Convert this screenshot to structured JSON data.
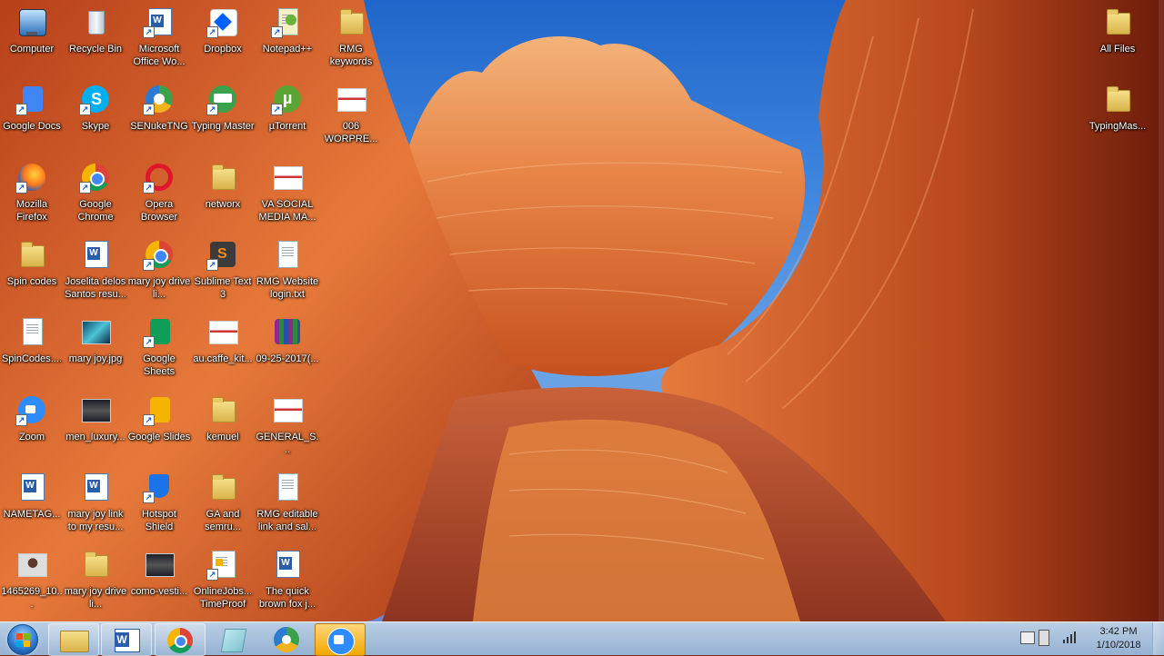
{
  "desktop": {
    "icons": [
      {
        "label": "Computer",
        "type": "computer",
        "icon": "computer-icon"
      },
      {
        "label": "Recycle Bin",
        "type": "recycle",
        "icon": "recycle-bin-icon"
      },
      {
        "label": "Microsoft Office Wo...",
        "type": "word-shortcut",
        "icon": "word-icon"
      },
      {
        "label": "Dropbox",
        "type": "dropbox",
        "icon": "dropbox-icon"
      },
      {
        "label": "Notepad++",
        "type": "notepadpp",
        "icon": "notepadpp-icon"
      },
      {
        "label": "RMG keywords",
        "type": "folder",
        "icon": "folder-icon"
      },
      {
        "label": "Google Docs",
        "type": "gdocs",
        "icon": "google-docs-icon"
      },
      {
        "label": "Skype",
        "type": "skype",
        "icon": "skype-icon"
      },
      {
        "label": "SENukeTNG",
        "type": "senuke",
        "icon": "senuke-icon"
      },
      {
        "label": "Typing Master",
        "type": "typingmaster",
        "icon": "typing-master-icon"
      },
      {
        "label": "µTorrent",
        "type": "utorrent",
        "icon": "utorrent-icon"
      },
      {
        "label": "006 WORPRE...",
        "type": "image",
        "icon": "image-file-icon"
      },
      {
        "label": "Mozilla Firefox",
        "type": "firefox",
        "icon": "firefox-icon"
      },
      {
        "label": "Google Chrome",
        "type": "chrome",
        "icon": "chrome-icon"
      },
      {
        "label": "Opera Browser",
        "type": "opera",
        "icon": "opera-icon"
      },
      {
        "label": "networx",
        "type": "folder",
        "icon": "folder-icon"
      },
      {
        "label": "VA SOCIAL MEDIA MA...",
        "type": "image",
        "icon": "image-file-icon"
      },
      {
        "label": "Spin codes",
        "type": "folder",
        "icon": "folder-icon"
      },
      {
        "label": "Joselita delos Santos resu...",
        "type": "worddoc",
        "icon": "word-document-icon"
      },
      {
        "label": "mary joy drive li...",
        "type": "chrome",
        "icon": "chrome-icon"
      },
      {
        "label": "Sublime Text 3",
        "type": "sublime",
        "icon": "sublime-text-icon"
      },
      {
        "label": "RMG Website login.txt",
        "type": "doc",
        "icon": "text-file-icon"
      },
      {
        "label": "SpinCodes....",
        "type": "doc",
        "icon": "text-file-icon"
      },
      {
        "label": "mary joy.jpg",
        "type": "photo",
        "icon": "photo-icon"
      },
      {
        "label": "Google Sheets",
        "type": "gsheets",
        "icon": "google-sheets-icon"
      },
      {
        "label": "au.caffe_kit...",
        "type": "image",
        "icon": "image-file-icon"
      },
      {
        "label": "09-25-2017(...",
        "type": "archive",
        "icon": "archive-icon"
      },
      {
        "label": "Zoom",
        "type": "zoom",
        "icon": "zoom-icon"
      },
      {
        "label": "men_luxury...",
        "type": "photo-dark",
        "icon": "photo-icon"
      },
      {
        "label": "Google Slides",
        "type": "gslides",
        "icon": "google-slides-icon"
      },
      {
        "label": "kemuel",
        "type": "folder",
        "icon": "folder-icon"
      },
      {
        "label": "GENERAL_S...",
        "type": "image",
        "icon": "image-file-icon"
      },
      {
        "label": "NAMETAG...",
        "type": "worddoc",
        "icon": "word-document-icon"
      },
      {
        "label": "mary joy link to my resu...",
        "type": "worddoc",
        "icon": "word-document-icon"
      },
      {
        "label": "Hotspot Shield",
        "type": "hotspot",
        "icon": "hotspot-shield-icon"
      },
      {
        "label": "GA and semru...",
        "type": "folder",
        "icon": "folder-icon"
      },
      {
        "label": "RMG editable link and sal...",
        "type": "doc",
        "icon": "text-file-icon"
      },
      {
        "label": "1465269_10...",
        "type": "photo-person",
        "icon": "photo-icon"
      },
      {
        "label": "mary joy drive li...",
        "type": "folder",
        "icon": "folder-icon"
      },
      {
        "label": "como-vesti...",
        "type": "photo-dark",
        "icon": "photo-icon"
      },
      {
        "label": "OnlineJobs... TimeProof",
        "type": "onlinejobs",
        "icon": "onlinejobs-icon"
      },
      {
        "label": "The quick brown fox j...",
        "type": "worddoc",
        "icon": "word-document-icon"
      }
    ],
    "right_icons": [
      {
        "label": "All Files",
        "type": "folder",
        "icon": "folder-icon"
      },
      {
        "label": "TypingMas...",
        "type": "folder",
        "icon": "folder-icon"
      }
    ]
  },
  "taskbar": {
    "start_label": "Start",
    "items": [
      {
        "name": "explorer",
        "icon": "file-explorer-icon",
        "state": "pinned"
      },
      {
        "name": "word",
        "icon": "word-icon",
        "state": "pinned"
      },
      {
        "name": "chrome",
        "icon": "chrome-icon",
        "state": "pinned"
      },
      {
        "name": "notepad",
        "icon": "notepad-icon",
        "state": "plain"
      },
      {
        "name": "senuke",
        "icon": "senuke-icon",
        "state": "plain"
      },
      {
        "name": "zoom",
        "icon": "zoom-icon",
        "state": "active"
      }
    ],
    "clock": {
      "time": "3:42 PM",
      "date": "1/10/2018"
    }
  },
  "colors": {
    "accent": "#2d7ad1",
    "taskbar": "#a9c8e8",
    "wallpaper_rock": "#d8652a"
  }
}
